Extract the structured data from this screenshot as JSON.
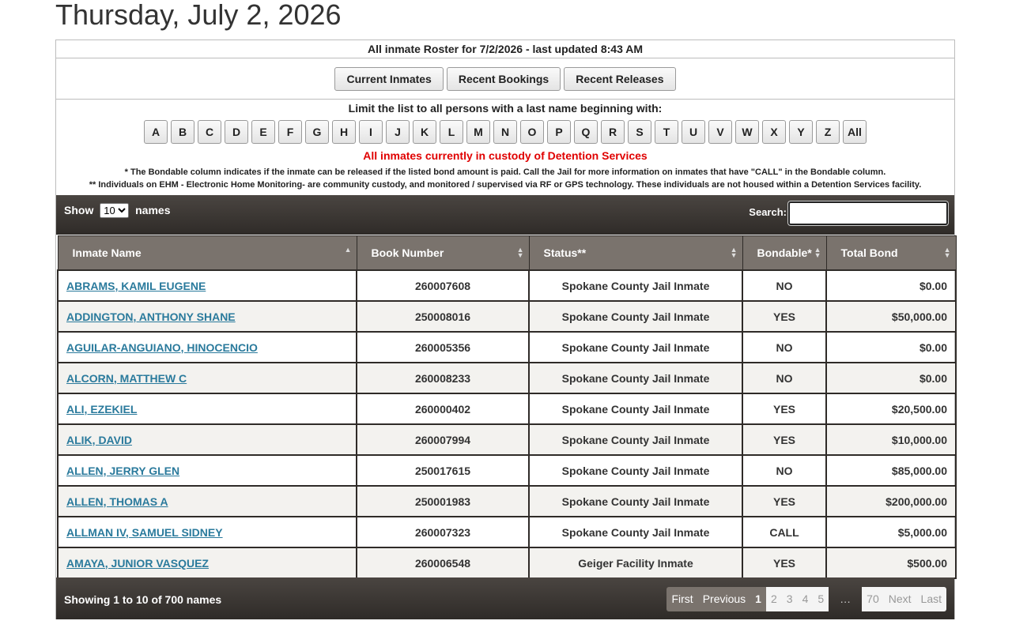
{
  "page_title": "Thursday, July 2, 2026",
  "roster_line": "All inmate Roster for 7/2/2026 - last updated 8:43 AM",
  "nav_buttons": [
    "Current Inmates",
    "Recent Bookings",
    "Recent Releases"
  ],
  "limit_text": "Limit the list to all persons with a last name beginning with:",
  "letters": [
    "A",
    "B",
    "C",
    "D",
    "E",
    "F",
    "G",
    "H",
    "I",
    "J",
    "K",
    "L",
    "M",
    "N",
    "O",
    "P",
    "Q",
    "R",
    "S",
    "T",
    "U",
    "V",
    "W",
    "X",
    "Y",
    "Z",
    "All"
  ],
  "custody_text": "All inmates currently in custody of Detention Services",
  "note1": "* The Bondable column indicates if the inmate can be released if the listed bond amount is paid. Call the Jail for more information on inmates that have \"CALL\" in the Bondable column.",
  "note2": "** Individuals on EHM - Electronic Home Monitoring- are community custody, and monitored / supervised via RF or GPS technology. These individuals are not housed within a Detention Services facility.",
  "toolbar": {
    "show_label": "Show",
    "show_value": "10",
    "names_label": "names",
    "search_label": "Search:",
    "search_value": ""
  },
  "columns": [
    "Inmate Name",
    "Book Number",
    "Status**",
    "Bondable*",
    "Total Bond"
  ],
  "rows": [
    {
      "name": "ABRAMS, KAMIL EUGENE",
      "book": "260007608",
      "status": "Spokane County Jail Inmate",
      "bondable": "NO",
      "bond": "$0.00"
    },
    {
      "name": "ADDINGTON, ANTHONY SHANE",
      "book": "250008016",
      "status": "Spokane County Jail Inmate",
      "bondable": "YES",
      "bond": "$50,000.00"
    },
    {
      "name": "AGUILAR-ANGUIANO, HINOCENCIO",
      "book": "260005356",
      "status": "Spokane County Jail Inmate",
      "bondable": "NO",
      "bond": "$0.00"
    },
    {
      "name": "ALCORN, MATTHEW C",
      "book": "260008233",
      "status": "Spokane County Jail Inmate",
      "bondable": "NO",
      "bond": "$0.00"
    },
    {
      "name": "ALI, EZEKIEL",
      "book": "260000402",
      "status": "Spokane County Jail Inmate",
      "bondable": "YES",
      "bond": "$20,500.00"
    },
    {
      "name": "ALIK, DAVID",
      "book": "260007994",
      "status": "Spokane County Jail Inmate",
      "bondable": "YES",
      "bond": "$10,000.00"
    },
    {
      "name": "ALLEN, JERRY GLEN",
      "book": "250017615",
      "status": "Spokane County Jail Inmate",
      "bondable": "NO",
      "bond": "$85,000.00"
    },
    {
      "name": "ALLEN, THOMAS A",
      "book": "250001983",
      "status": "Spokane County Jail Inmate",
      "bondable": "YES",
      "bond": "$200,000.00"
    },
    {
      "name": "ALLMAN IV, SAMUEL SIDNEY",
      "book": "260007323",
      "status": "Spokane County Jail Inmate",
      "bondable": "CALL",
      "bond": "$5,000.00"
    },
    {
      "name": "AMAYA, JUNIOR VASQUEZ",
      "book": "260006548",
      "status": "Geiger Facility Inmate",
      "bondable": "YES",
      "bond": "$500.00"
    }
  ],
  "footer": {
    "showing": "Showing 1 to 10 of 700 names",
    "pager": {
      "first": "First",
      "previous": "Previous",
      "pages": [
        "1",
        "2",
        "3",
        "4",
        "5"
      ],
      "ellipsis": "…",
      "last_page": "70",
      "next": "Next",
      "last": "Last"
    }
  }
}
